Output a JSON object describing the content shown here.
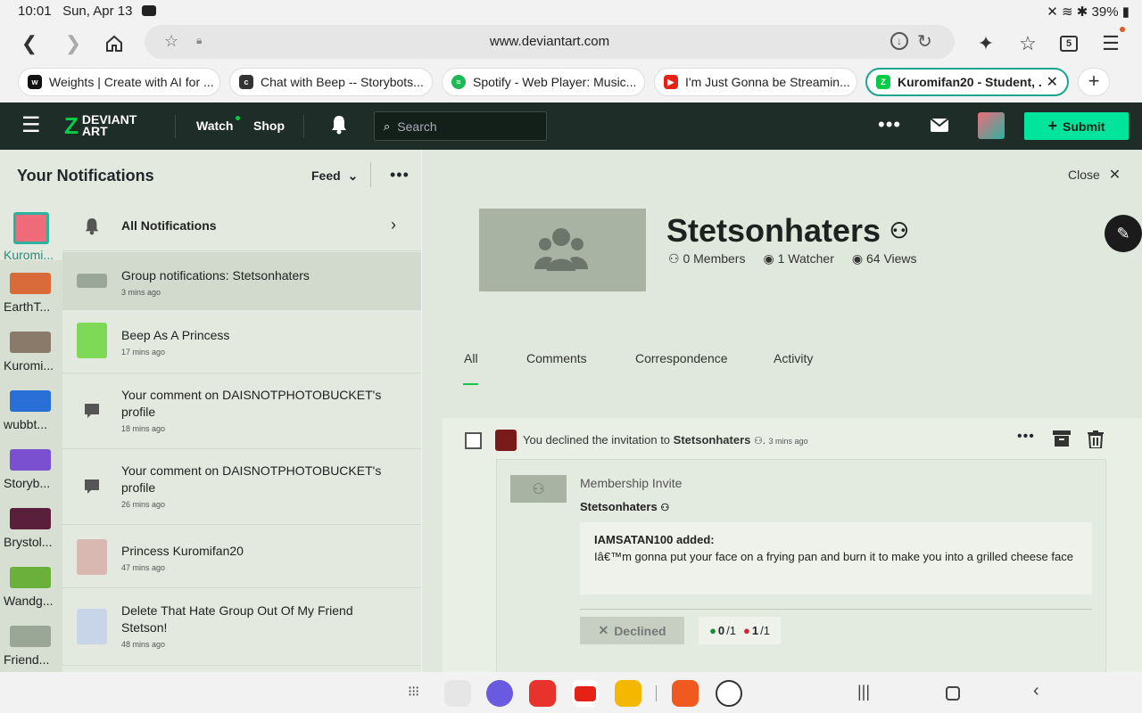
{
  "status": {
    "time": "10:01",
    "date": "Sun, Apr 13",
    "battery": "39%"
  },
  "browser": {
    "url": "www.deviantart.com",
    "tab_count": "5"
  },
  "tabs": [
    {
      "label": "Weights | Create with AI for ...",
      "color": "#111"
    },
    {
      "label": "Chat with Beep -- Storybots...",
      "color": "#333"
    },
    {
      "label": "Spotify - Web Player: Music...",
      "color": "#1db954"
    },
    {
      "label": "I'm Just Gonna be Streamin...",
      "color": "#e62117"
    },
    {
      "label": "Kuromifan20 - Student, ...",
      "color": "#05cc47"
    }
  ],
  "header": {
    "logo_line1": "DEVIANT",
    "logo_line2": "ART",
    "watch": "Watch",
    "shop": "Shop",
    "search_placeholder": "Search",
    "submit": "Submit"
  },
  "left": {
    "title": "Your Notifications",
    "feed": "Feed",
    "avatars": [
      {
        "name": "Kuromi...",
        "color": "#2bb3a0"
      },
      {
        "name": "EarthT...",
        "color": "#d96a3a"
      },
      {
        "name": "Kuromi...",
        "color": "#8a7a6a"
      },
      {
        "name": "wubbt...",
        "color": "#2a6fd8"
      },
      {
        "name": "Storyb...",
        "color": "#7a4fd0"
      },
      {
        "name": "Brystol...",
        "color": "#5a1f3a"
      },
      {
        "name": "Wandg...",
        "color": "#6ab03a"
      },
      {
        "name": "Friend...",
        "color": "#9aa696"
      }
    ],
    "notifications": [
      {
        "title": "All Notifications",
        "time": ""
      },
      {
        "title": "Group notifications: Stetsonhaters",
        "time": "3 mins ago"
      },
      {
        "title": "Beep As A Princess",
        "time": "17 mins ago"
      },
      {
        "title": "Your comment on DAISNOTPHOTOBUCKET's profile",
        "time": "18 mins ago"
      },
      {
        "title": "Your comment on DAISNOTPHOTOBUCKET's profile",
        "time": "26 mins ago"
      },
      {
        "title": "Princess Kuromifan20",
        "time": "47 mins ago"
      },
      {
        "title": "Delete That Hate Group Out Of My Friend Stetson!",
        "time": "48 mins ago"
      }
    ]
  },
  "right": {
    "close": "Close",
    "group_name": "Stetsonhaters",
    "members": "0 Members",
    "watchers": "1 Watcher",
    "views": "64 Views",
    "tabs": [
      "All",
      "Comments",
      "Correspondence",
      "Activity"
    ],
    "item": {
      "prefix": "You declined the invitation to",
      "group": "Stetsonhaters",
      "time": "3 mins ago",
      "card_title": "Membership Invite",
      "card_group": "Stetsonhaters",
      "author": "IAMSATAN100  added:",
      "message": "Iâ€™m gonna put your face on a frying pan and burn it to make you into a grilled cheese face",
      "declined": "Declined",
      "vote_yes": "0",
      "vote_yes_total": "/1",
      "vote_no": "1",
      "vote_no_total": "/1"
    }
  }
}
